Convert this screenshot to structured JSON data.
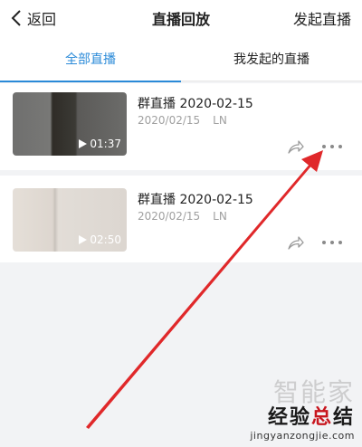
{
  "header": {
    "back_label": "返回",
    "title": "直播回放",
    "action_label": "发起直播"
  },
  "tabs": [
    {
      "label": "全部直播",
      "active": true
    },
    {
      "label": "我发起的直播",
      "active": false
    }
  ],
  "replays": [
    {
      "title": "群直播 2020-02-15",
      "date": "2020/02/15",
      "author": "LN",
      "duration": "01:37"
    },
    {
      "title": "群直播 2020-02-15",
      "date": "2020/02/15",
      "author": "LN",
      "duration": "02:50"
    }
  ],
  "watermark": {
    "top": "智能家",
    "brand_black_1": "经验",
    "brand_red": "总",
    "brand_black_2": "结",
    "url": "jingyanzongjie.com"
  },
  "colors": {
    "accent": "#2a8ad8",
    "annotation_arrow": "#e0282a",
    "background": "#f2f3f5"
  },
  "icons": [
    "chevron-left-icon",
    "play-icon",
    "share-icon",
    "more-icon"
  ]
}
